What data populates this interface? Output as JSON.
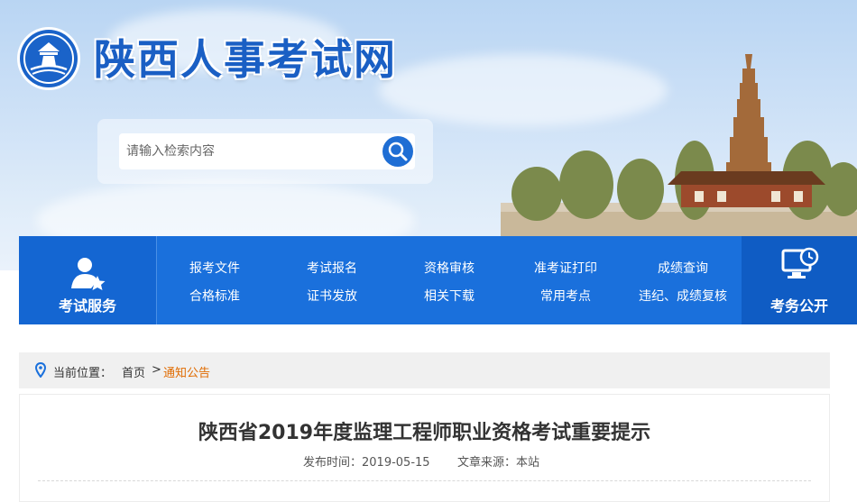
{
  "site": {
    "title": "陕西人事考试网"
  },
  "search": {
    "placeholder": "请输入检索内容"
  },
  "nav": {
    "left_caption": "考试服务",
    "right_caption": "考务公开",
    "row1": [
      "报考文件",
      "考试报名",
      "资格审核",
      "准考证打印",
      "成绩查询"
    ],
    "row2": [
      "合格标准",
      "证书发放",
      "相关下载",
      "常用考点",
      "违纪、成绩复核"
    ]
  },
  "breadcrumb": {
    "prefix": "当前位置：",
    "home": "首页",
    "separator": ">",
    "current": "通知公告"
  },
  "article": {
    "title": "陕西省2019年度监理工程师职业资格考试重要提示",
    "publish_label": "发布时间：",
    "publish_date": "2019-05-15",
    "source_label": "文章来源：",
    "source": "本站"
  },
  "colors": {
    "brand_blue": "#1a70dc",
    "breadcrumb_current": "#e06b00"
  },
  "icons": {
    "logo": "pagoda-emblem-icon",
    "search": "search-icon",
    "service": "person-star-icon",
    "public": "monitor-clock-icon",
    "location": "location-pin-icon"
  }
}
